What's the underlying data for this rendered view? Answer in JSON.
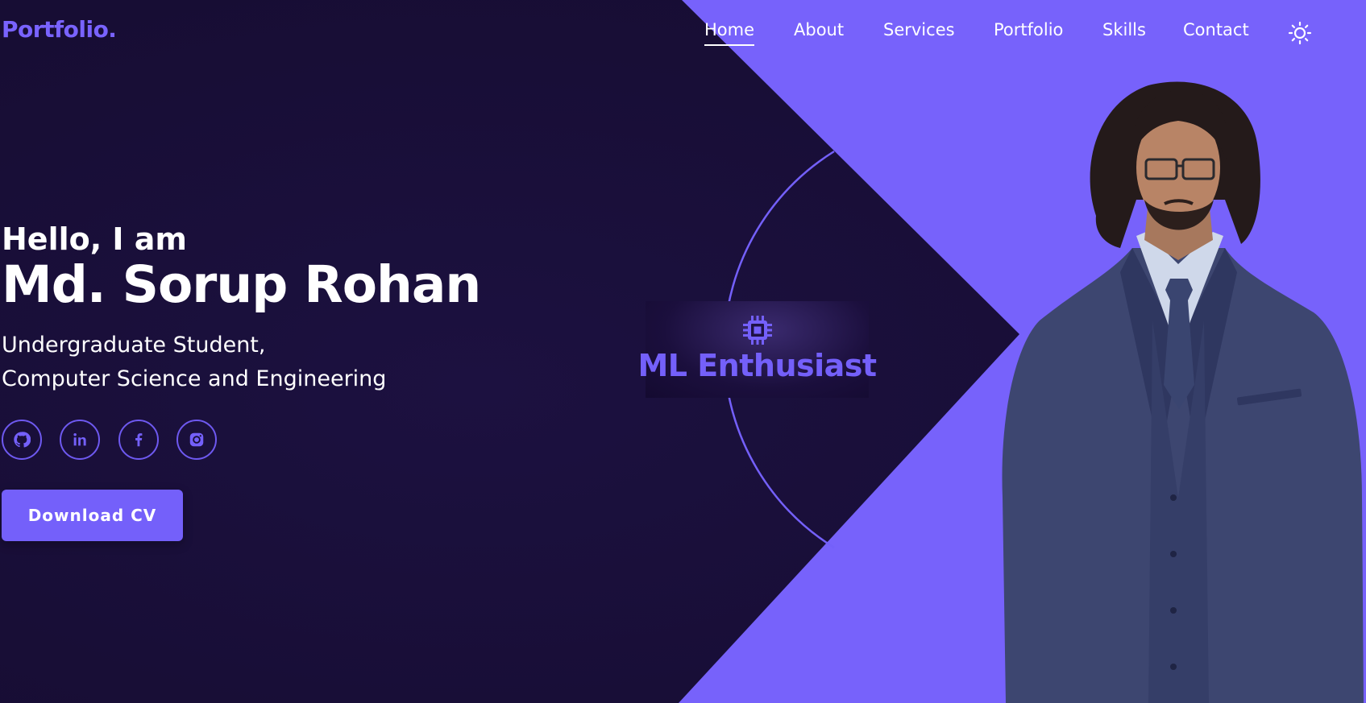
{
  "header": {
    "logo": "Portfolio.",
    "nav": [
      {
        "label": "Home",
        "active": true
      },
      {
        "label": "About",
        "active": false
      },
      {
        "label": "Services",
        "active": false
      },
      {
        "label": "Portfolio",
        "active": false
      },
      {
        "label": "Skills",
        "active": false
      },
      {
        "label": "Contact",
        "active": false
      }
    ],
    "theme_icon": "sun-icon"
  },
  "hero": {
    "greeting": "Hello, I am",
    "name": "Md. Sorup Rohan",
    "role_line1": "Undergraduate Student,",
    "role_line2": "Computer Science and Engineering",
    "socials": [
      {
        "icon": "github-icon"
      },
      {
        "icon": "linkedin-icon"
      },
      {
        "icon": "facebook-icon"
      },
      {
        "icon": "instagram-icon"
      }
    ],
    "cv_button": "Download CV"
  },
  "card": {
    "icon": "cpu-chip-icon",
    "text": "ML Enthusiast"
  },
  "colors": {
    "background": "#170d34",
    "accent": "#7460fa",
    "text": "#ffffff"
  }
}
